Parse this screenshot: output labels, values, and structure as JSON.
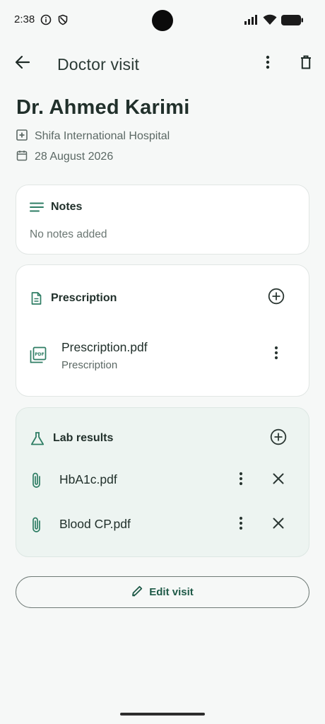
{
  "status_bar": {
    "time": "2:38"
  },
  "top_bar": {
    "title": "Doctor visit"
  },
  "visit": {
    "doctor": "Dr. Ahmed Karimi",
    "hospital": "Shifa International Hospital",
    "date": "28 August 2026"
  },
  "notes": {
    "title": "Notes",
    "empty_text": "No notes added"
  },
  "prescription": {
    "title": "Prescription",
    "files": [
      {
        "name": "Prescription.pdf",
        "label": "Prescription"
      }
    ]
  },
  "lab_results": {
    "title": "Lab results",
    "files": [
      {
        "name": "HbA1c.pdf"
      },
      {
        "name": "Blood CP.pdf"
      }
    ]
  },
  "actions": {
    "edit_label": "Edit visit"
  },
  "colors": {
    "accent": "#2e7d64",
    "background": "#f6f8f7",
    "lab_card": "#edf4f1"
  },
  "icons": [
    "info-icon",
    "shield-icon",
    "signal-icon",
    "wifi-icon",
    "battery-icon",
    "back-arrow-icon",
    "more-vert-icon",
    "trash-icon",
    "hospital-icon",
    "calendar-icon",
    "notes-icon",
    "document-icon",
    "add-circle-icon",
    "pdf-file-icon",
    "flask-icon",
    "paperclip-icon",
    "close-icon",
    "pencil-icon"
  ]
}
